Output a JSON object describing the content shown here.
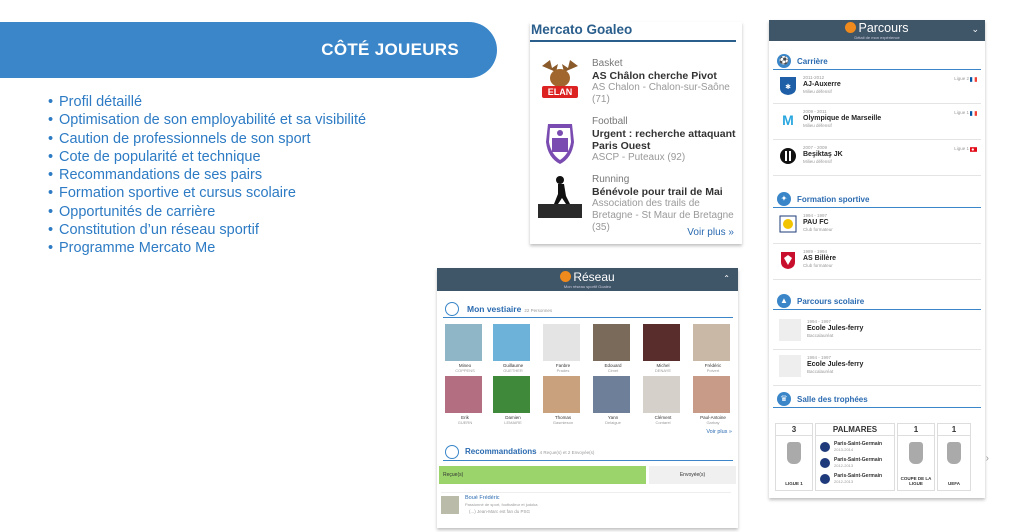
{
  "banner": {
    "title": "CÔTÉ JOUEURS",
    "color": "#3a86c9"
  },
  "features": [
    "Profil détaillé",
    "Optimisation de son employabilité et sa visibilité",
    "Caution de professionnels de son sport",
    "Cote de popularité et technique",
    "Recommandations de ses pairs",
    "Formation sportive et cursus scolaire",
    "Opportunités de carrière",
    "Constitution d’un réseau sportif",
    "Programme Mercato Me"
  ],
  "mercato": {
    "title": "Mercato Goaleo",
    "items": [
      {
        "sport": "Basket",
        "headline": "AS Châlon cherche Pivot",
        "sub": "AS Chalon - Chalon-sur-Saône (71)",
        "logo": "elan-moose-logo"
      },
      {
        "sport": "Football",
        "headline": "Urgent : recherche attaquant Paris Ouest",
        "sub": "ASCP - Puteaux (92)",
        "logo": "ascp-crest-logo"
      },
      {
        "sport": "Running",
        "headline": "Bénévole pour trail de Mai",
        "sub": "Association des trails de Bretagne - St Maur de Bretagne (35)",
        "logo": "runner-silhouette"
      }
    ],
    "more": "Voir plus »"
  },
  "parcours": {
    "title": "Parcours",
    "subtitle": "Détail de mon expérience",
    "sections": {
      "carriere": "Carrière",
      "formation": "Formation sportive",
      "scolaire": "Parcours scolaire",
      "trophees": "Salle des trophées"
    },
    "career": [
      {
        "date": "2011-2012",
        "club": "AJ-Auxerre",
        "role": "Milieu défensif",
        "league": "Ligue 2"
      },
      {
        "date": "2009 - 2011",
        "club": "Olympique de Marseille",
        "role": "Milieu défensif",
        "league": "Ligue 1"
      },
      {
        "date": "2007 - 2009",
        "club": "Beşiktaş JK",
        "role": "Milieu défensif",
        "league": "Ligue 1"
      }
    ],
    "training": [
      {
        "date": "1994 - 1997",
        "club": "PAU FC",
        "role": "Club formateur"
      },
      {
        "date": "1989 - 1994",
        "club": "AS Billère",
        "role": "Club formateur"
      }
    ],
    "school": [
      {
        "date": "1994 - 1997",
        "school": "Ecole Jules-ferry",
        "degree": "Baccalauréat"
      },
      {
        "date": "1994 - 1997",
        "school": "Ecole Jules-ferry",
        "degree": "Baccalauréat"
      }
    ],
    "trophies": {
      "ligue1": {
        "count": "3",
        "label": "LIGUE 1"
      },
      "palmares": {
        "label": "PALMARES",
        "items": [
          {
            "club": "Paris-Saint-Germain",
            "years": "2013-2014"
          },
          {
            "club": "Paris-Saint-Germain",
            "years": "2012-2013"
          },
          {
            "club": "Paris-Saint-Germain",
            "years": "2012-2013"
          }
        ]
      },
      "coupe": {
        "count": "1",
        "label": "COUPE DE LA LIGUE"
      },
      "uefa": {
        "count": "1",
        "label": "UEFA"
      }
    }
  },
  "reseau": {
    "title": "Réseau",
    "subtitle": "Mon réseau sportif Goaleo",
    "vestiaire": "Mon vestiaire",
    "vestiaire_count": "22 Personnes",
    "people": [
      {
        "name": "Mineo",
        "role": "COPPENS"
      },
      {
        "name": "Guillaume",
        "role": "GUETHER"
      },
      {
        "name": "Fanbre",
        "role": "Prades"
      },
      {
        "name": "Edouard",
        "role": "Cimet"
      },
      {
        "name": "Michel",
        "role": "DENAYE"
      },
      {
        "name": "Frédéric",
        "role": "Poivert"
      },
      {
        "name": "Erik",
        "role": "GUERN"
      },
      {
        "name": "Damien",
        "role": "LEMAIRE"
      },
      {
        "name": "Thomas",
        "role": "Gasmieson"
      },
      {
        "name": "Yann",
        "role": "Delaigue"
      },
      {
        "name": "Clément",
        "role": "Contarel"
      },
      {
        "name": "Paul-Antoine",
        "role": "Garbay"
      }
    ],
    "more": "Voir plus »",
    "recommandations": "Recommandations",
    "reco_count": "4 Reçue(s) et 2 Envoyée(s)",
    "tab_recues": "Reçue(s)",
    "tab_envoyees": "Envoyée(s)",
    "reco_item": {
      "name": "Boué Frédéric",
      "role": "Passionné de sport, footballeur et judoka",
      "quote": "(...) Jean-Marc est fan du PSG"
    }
  }
}
